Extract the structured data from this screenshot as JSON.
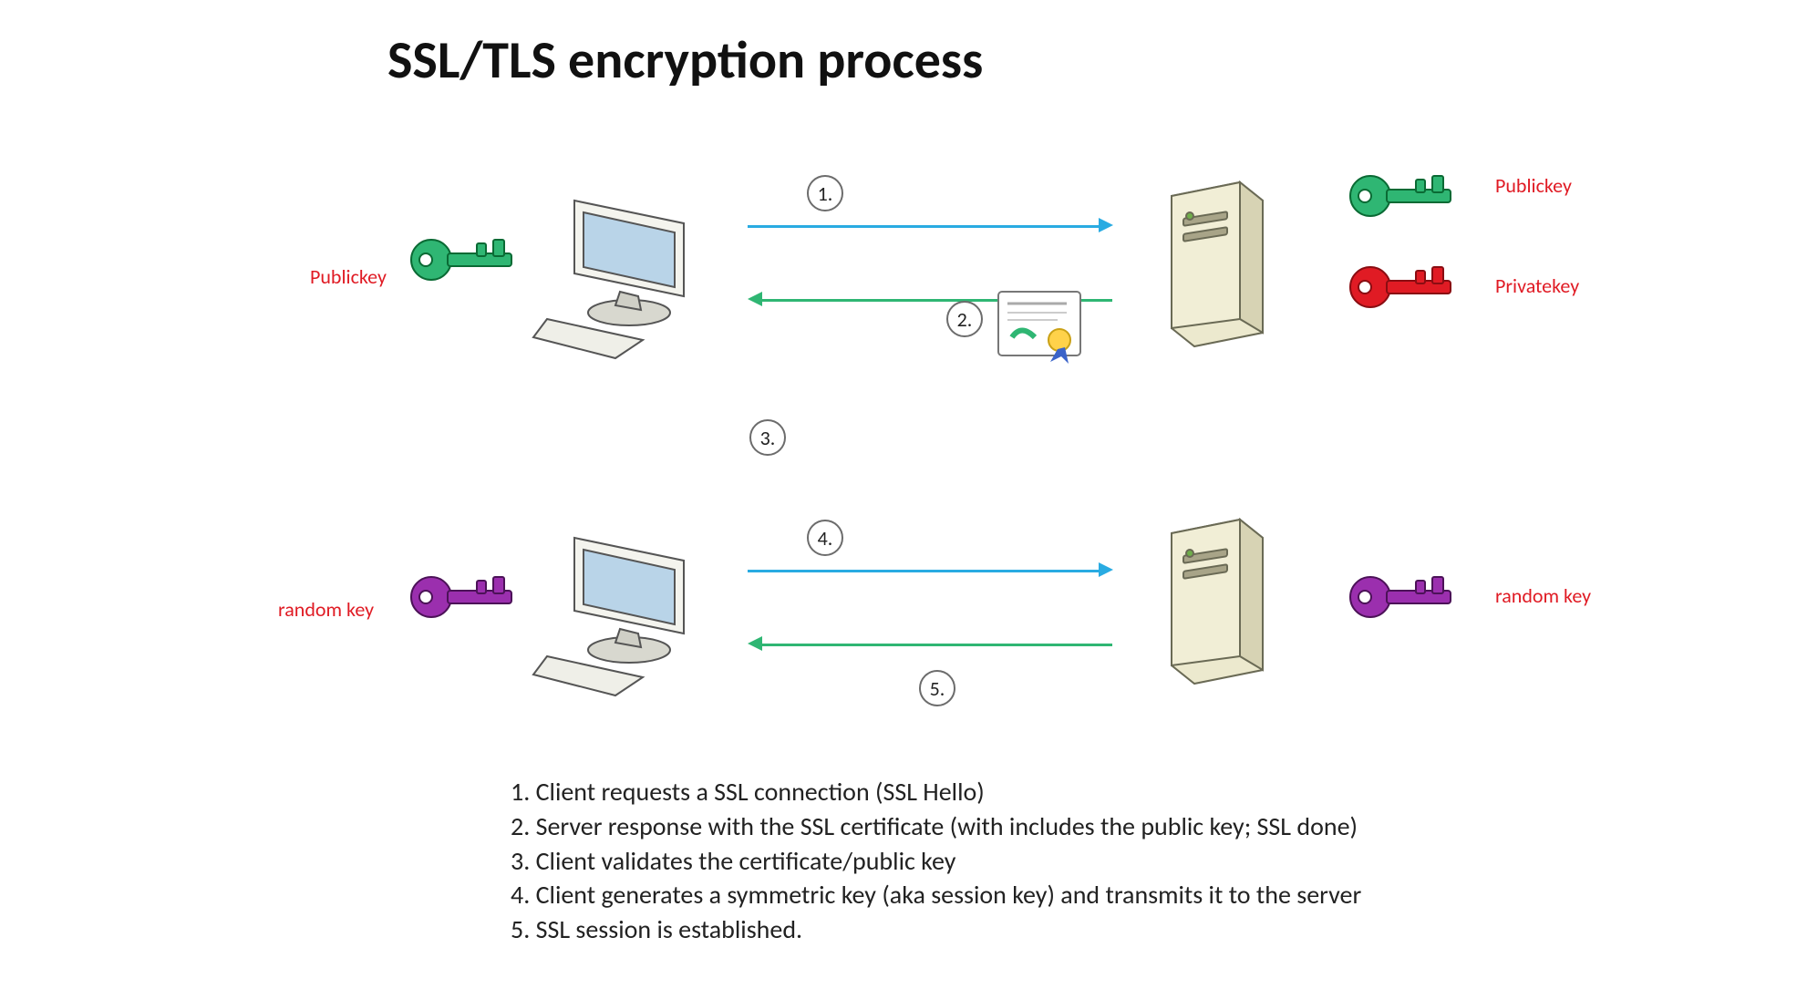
{
  "title": "SSL/TLS encryption process",
  "labels": {
    "client_public_key": "Publickey",
    "server_public_key": "Publickey",
    "server_private_key": "Privatekey",
    "client_random_key": "random key",
    "server_random_key": "random key"
  },
  "steps_circles": {
    "s1": "1.",
    "s2": "2.",
    "s3": "3.",
    "s4": "4.",
    "s5": "5."
  },
  "legend": [
    "1. Client requests a SSL connection (SSL Hello)",
    "2. Server response with the SSL certificate (with includes the public key; SSL done)",
    "3. Client validates the certificate/public key",
    "4. Client generates a symmetric key (aka session key) and transmits it to the server",
    "5. SSL session is established."
  ],
  "colors": {
    "blue": "#29abe2",
    "green_arrow": "#2fb673",
    "green_key": "#2fb673",
    "red_key": "#e01b24",
    "purple_key": "#9b2fae"
  }
}
